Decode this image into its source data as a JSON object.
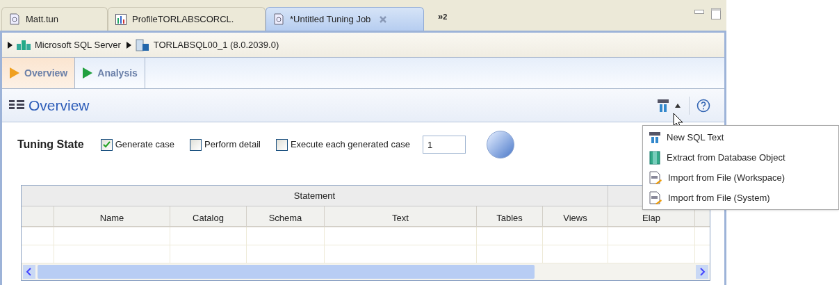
{
  "editor_tabs": [
    {
      "label": "Matt.tun",
      "kind": "tuning",
      "selected": false,
      "closable": false
    },
    {
      "label": "ProfileTORLABSCORCL.",
      "kind": "profile",
      "selected": false,
      "closable": false
    },
    {
      "label": "*Untitled Tuning Job",
      "kind": "tuning",
      "selected": true,
      "closable": true
    }
  ],
  "overflow": {
    "label": "»",
    "count": "2"
  },
  "breadcrumb": [
    {
      "label": "Microsoft SQL Server",
      "kind": "server_group"
    },
    {
      "label": "TORLABSQL00_1 (8.0.2039.0)",
      "kind": "server"
    }
  ],
  "form_tabs": [
    {
      "label": "Overview",
      "selected": true,
      "color": "#f0a020"
    },
    {
      "label": "Analysis",
      "selected": false,
      "color": "#22a040"
    }
  ],
  "section_title": "Overview",
  "tuning_state": {
    "label": "Tuning State",
    "options": [
      {
        "label": "Generate case",
        "checked": true
      },
      {
        "label": "Perform detail",
        "checked": false
      },
      {
        "label": "Execute each generated case",
        "checked": false
      }
    ],
    "count_value": "1"
  },
  "table": {
    "group_headers": [
      "Statement"
    ],
    "columns": [
      "Name",
      "Catalog",
      "Schema",
      "Text",
      "Tables",
      "Views",
      "Elap"
    ]
  },
  "menu": [
    {
      "label": "New SQL Text",
      "kind": "sql"
    },
    {
      "label": "Extract from Database Object",
      "kind": "db"
    },
    {
      "label": "Import from File (Workspace)",
      "kind": "file"
    },
    {
      "label": "Import from File (System)",
      "kind": "file"
    }
  ]
}
